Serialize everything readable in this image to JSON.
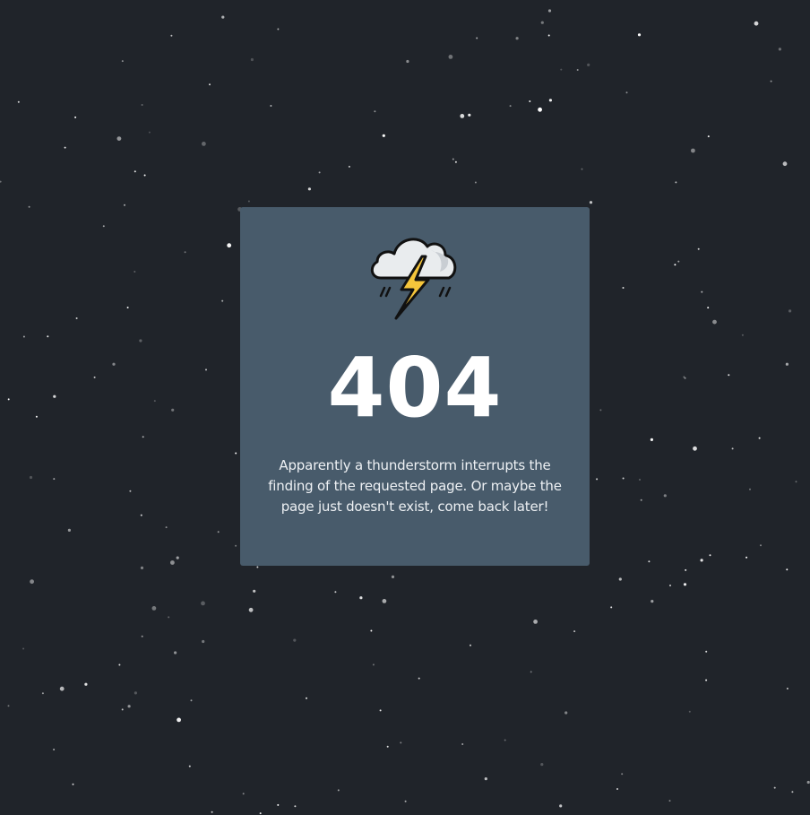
{
  "error_card": {
    "code": "404",
    "message": "Apparently a thunderstorm interrupts the finding of the requested page. Or maybe the page just doesn't exist, come back later!",
    "icon": "thunderstorm-cloud-icon"
  },
  "background": {
    "page_color": "#20242a",
    "card_color": "#485b6b",
    "star_color": "#ffffff"
  }
}
